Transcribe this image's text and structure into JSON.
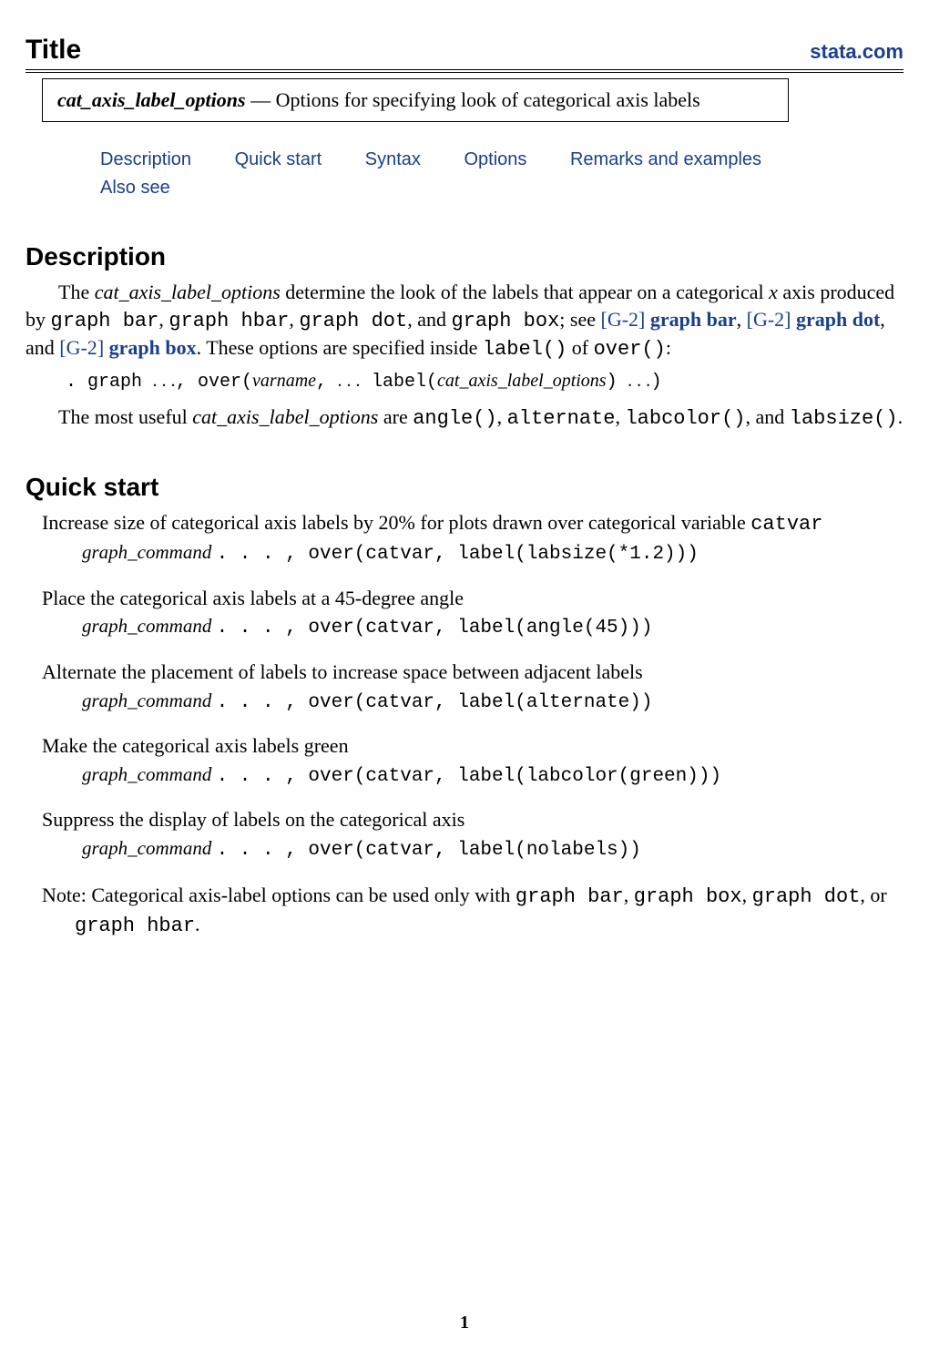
{
  "header": {
    "title": "Title",
    "site_link": "stata.com"
  },
  "entry": {
    "name": "cat_axis_label_options",
    "dash": " — ",
    "desc": "Options for specifying look of categorical axis labels"
  },
  "nav": {
    "items": [
      "Description",
      "Quick start",
      "Syntax",
      "Options",
      "Remarks and examples",
      "Also see"
    ]
  },
  "description": {
    "heading": "Description",
    "p1_pre": "The ",
    "p1_term": "cat_axis_label_options",
    "p1_mid": " determine the look of the labels that appear on a categorical ",
    "p1_x": "x",
    "p1_after_x": " axis produced by ",
    "p1_c1": "graph bar",
    "p1_s1": ", ",
    "p1_c2": "graph hbar",
    "p1_s2": ", ",
    "p1_c3": "graph dot",
    "p1_s3": ", and ",
    "p1_c4": "graph box",
    "p1_see": "; see ",
    "p1_ref1_pre": "[",
    "p1_ref1_sc": "G-2",
    "p1_ref1_post": "] ",
    "p1_ref1_link": "graph bar",
    "p1_refsep": ", ",
    "p1_ref2_pre": "[",
    "p1_ref2_sc": "G-2",
    "p1_ref2_post": "] ",
    "p1_ref2_link": "graph dot",
    "p1_and": ", and ",
    "p1_ref3_pre": "[",
    "p1_ref3_sc": "G-2",
    "p1_ref3_post": "] ",
    "p1_ref3_link": "graph box",
    "p1_tail1": ". These options are specified inside ",
    "p1_labelfn": "label()",
    "p1_of": " of ",
    "p1_overfn": "over()",
    "p1_colon": ":",
    "code": {
      "dot": ". graph ",
      "ell1": ". . .",
      "over": ", over(",
      "varname": "varname",
      "comma_ell": ", ",
      "ell2": ". . .",
      "label": " label(",
      "opts": "cat_axis_label_options",
      "close_label": ") ",
      "ell3": ". . .",
      "close_over": ")"
    },
    "p2_pre": "The most useful ",
    "p2_term": "cat_axis_label_options",
    "p2_are": " are ",
    "p2_f1": "angle()",
    "p2_c1": ", ",
    "p2_f2": "alternate",
    "p2_c2": ", ",
    "p2_f3": "labcolor()",
    "p2_c3": ", and ",
    "p2_f4": "labsize()",
    "p2_end": "."
  },
  "quickstart": {
    "heading": "Quick start",
    "items": [
      {
        "text_pre": "Increase size of categorical axis labels by 20% for plots drawn over categorical variable ",
        "text_tt": "catvar",
        "text_post": "",
        "code_gc": "graph_command ",
        "code_rest": ". . . , over(catvar, label(labsize(*1.2)))"
      },
      {
        "text_pre": "Place the categorical axis labels at a 45-degree angle",
        "text_tt": "",
        "text_post": "",
        "code_gc": "graph_command ",
        "code_rest": ". . . , over(catvar, label(angle(45)))"
      },
      {
        "text_pre": "Alternate the placement of labels to increase space between adjacent labels",
        "text_tt": "",
        "text_post": "",
        "code_gc": "graph_command ",
        "code_rest": ". . . , over(catvar, label(alternate))"
      },
      {
        "text_pre": "Make the categorical axis labels green",
        "text_tt": "",
        "text_post": "",
        "code_gc": "graph_command ",
        "code_rest": ". . . , over(catvar, label(labcolor(green)))"
      },
      {
        "text_pre": "Suppress the display of labels on the categorical axis",
        "text_tt": "",
        "text_post": "",
        "code_gc": "graph_command ",
        "code_rest": ". . . , over(catvar, label(nolabels))"
      }
    ],
    "note_pre": "Note: Categorical axis-label options can be used only with ",
    "note_c1": "graph bar",
    "note_s1": ", ",
    "note_c2": "graph box",
    "note_s2": ", ",
    "note_c3": "graph dot",
    "note_s3": ", or ",
    "note_c4": "graph hbar",
    "note_end": "."
  },
  "page_number": "1"
}
